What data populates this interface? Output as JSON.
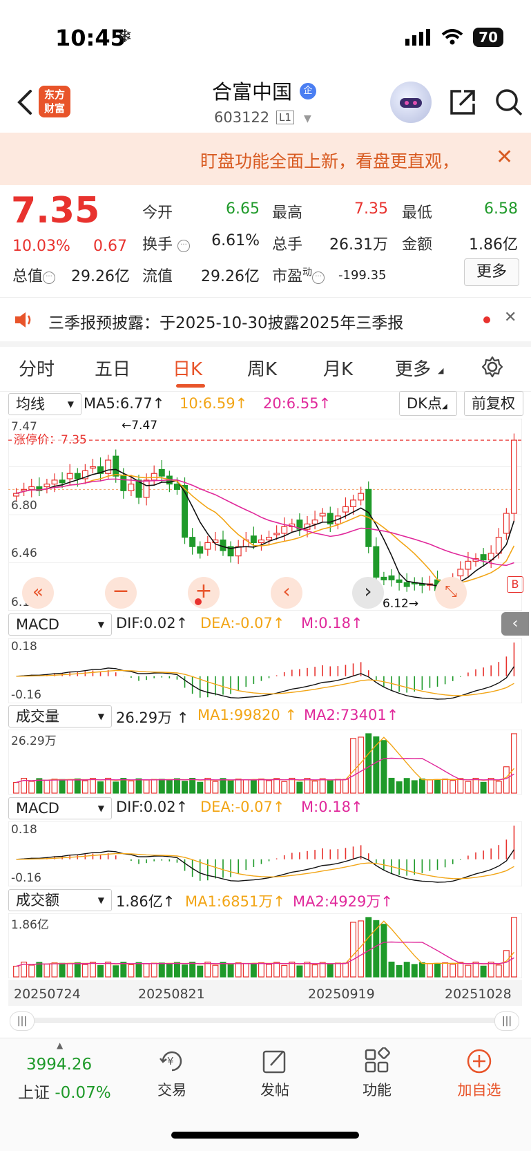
{
  "status": {
    "time": "10:45",
    "battery": "70"
  },
  "header": {
    "logo_line1": "东方",
    "logo_line2": "财富",
    "name": "合富中国",
    "ent_badge": "企",
    "code": "603122",
    "level": "L1"
  },
  "banner": {
    "text": "盯盘功能全面上新，看盘更直观，"
  },
  "quote": {
    "price": "7.35",
    "pct": "10.03%",
    "change": "0.67",
    "open_label": "今开",
    "open": "6.65",
    "high_label": "最高",
    "high": "7.35",
    "low_label": "最低",
    "low": "6.58",
    "turnover_label": "换手",
    "turnover": "6.61%",
    "volume_label": "总手",
    "volume": "26.31万",
    "amount_label": "金额",
    "amount": "1.86亿",
    "mktcap_label": "总值",
    "mktcap": "29.26亿",
    "float_label": "流值",
    "float": "29.26亿",
    "pe_label": "市盈",
    "pe_sup": "动",
    "pe": "-199.35",
    "more": "更多"
  },
  "notice": {
    "text": "三季报预披露：于2025-10-30披露2025年三季报"
  },
  "tabs": [
    "分时",
    "五日",
    "日K",
    "周K",
    "月K",
    "更多"
  ],
  "active_tab": 2,
  "ma_row": {
    "selector": "均线",
    "ma5": "MA5:6.77",
    "ma10": "10:6.59",
    "ma20": "20:6.55",
    "dk": "DK点",
    "fq": "前复权"
  },
  "kline": {
    "y_labels": [
      "7.47",
      "6.80",
      "6.46",
      "6.12"
    ],
    "limit_label": "涨停价：7.35",
    "high_mark": "←7.47",
    "low_mark": "6.12→",
    "b_mark": "B"
  },
  "macd1": {
    "selector": "MACD",
    "dif": "DIF:0.02",
    "dea": "DEA:-0.07",
    "m": "M:0.18",
    "y_top": "0.18",
    "y_bot": "-0.16"
  },
  "vol": {
    "selector": "成交量",
    "value": "26.29万",
    "ma1": "MA1:99820",
    "ma2": "MA2:73401",
    "y_top": "26.29万"
  },
  "macd2": {
    "selector": "MACD",
    "dif": "DIF:0.02",
    "dea": "DEA:-0.07",
    "m": "M:0.18",
    "y_top": "0.18",
    "y_bot": "-0.16"
  },
  "amt": {
    "selector": "成交额",
    "value": "1.86亿",
    "ma1": "MA1:6851万",
    "ma2": "MA2:4929万",
    "y_top": "1.86亿"
  },
  "dates": [
    "20250724",
    "20250821",
    "20250919",
    "20251028"
  ],
  "bottom": {
    "index_value": "3994.26",
    "index_name": "上证",
    "index_pct": "-0.07%",
    "trade": "交易",
    "post": "发帖",
    "func": "功能",
    "add": "加自选"
  },
  "colors": {
    "up": "#e8322e",
    "down": "#1f9a2a",
    "ma10": "#f2a516",
    "ma20": "#e0299b",
    "accent": "#e8542a"
  },
  "chart_data": {
    "type": "candlestick",
    "ylim": [
      6.12,
      7.47
    ],
    "x_ticks": [
      "20250724",
      "20250821",
      "20250919",
      "20251028"
    ],
    "closes": [
      6.95,
      6.98,
      7.0,
      6.97,
      7.02,
      7.05,
      7.03,
      7.1,
      7.06,
      7.12,
      7.15,
      7.1,
      7.2,
      7.08,
      6.97,
      7.02,
      6.92,
      7.05,
      7.1,
      7.08,
      7.02,
      6.98,
      6.62,
      6.55,
      6.5,
      6.58,
      6.6,
      6.52,
      6.48,
      6.55,
      6.6,
      6.58,
      6.6,
      6.62,
      6.65,
      6.7,
      6.72,
      6.68,
      6.72,
      6.75,
      6.8,
      6.72,
      6.78,
      6.85,
      6.9,
      6.95,
      6.55,
      6.32,
      6.3,
      6.3,
      6.28,
      6.25,
      6.27,
      6.26,
      6.27,
      6.22,
      6.26,
      6.3,
      6.38,
      6.44,
      6.46,
      6.45,
      6.5,
      6.62,
      6.8,
      7.35
    ]
  }
}
